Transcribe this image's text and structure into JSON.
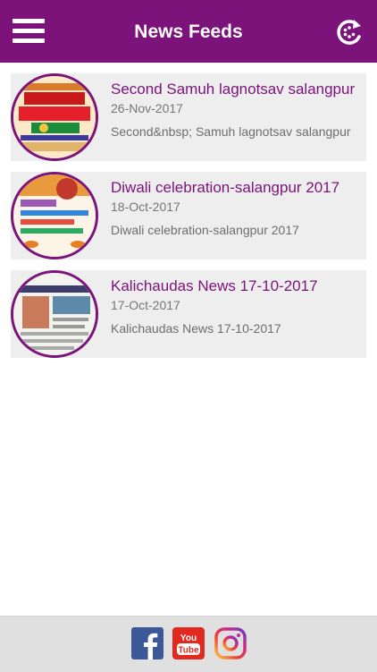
{
  "header": {
    "title": "News Feeds",
    "menu_icon": "hamburger-menu-icon",
    "refresh_icon": "refresh-icon",
    "background_color": "#7b137b"
  },
  "news": [
    {
      "title": "Second  Samuh lagnotsav salangpur",
      "date": "26-Nov-2017",
      "description": "Second&nbsp; Samuh lagnotsav salangpur",
      "thumbnail": "event-poster-thumbnail"
    },
    {
      "title": "Diwali celebration-salangpur 2017",
      "date": "18-Oct-2017",
      "description": "Diwali celebration-salangpur 2017",
      "thumbnail": "celebration-poster-thumbnail"
    },
    {
      "title": "Kalichaudas News 17-10-2017",
      "date": "17-Oct-2017",
      "description": "Kalichaudas News 17-10-2017",
      "thumbnail": "newspaper-clipping-thumbnail"
    }
  ],
  "footer": {
    "icons": [
      "facebook-icon",
      "youtube-icon",
      "instagram-icon"
    ],
    "youtube_text": "You Tube"
  }
}
